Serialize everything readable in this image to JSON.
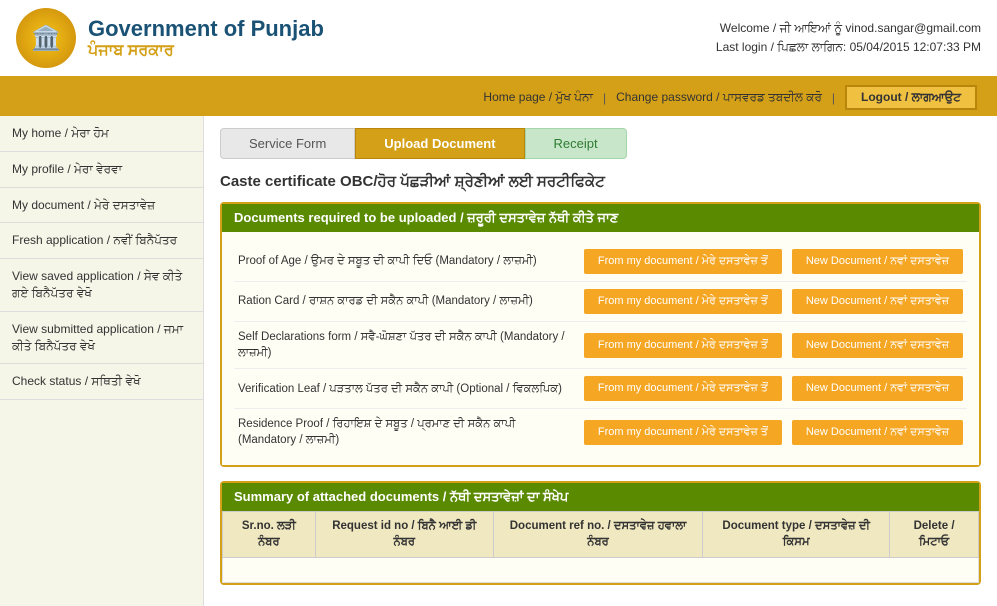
{
  "header": {
    "title": "Government of Punjab",
    "subtitle": "ਪੰਜਾਬ ਸਰਕਾਰ",
    "welcome_label": "Welcome / ਜੀ ਆਇਆਂ ਨੂੰ",
    "user_email": "vinod.sangar@gmail.com",
    "last_login_label": "Last login / ਪਿਛਲਾ ਲਾਗਿਨ:",
    "last_login_time": "05/04/2015 12:07:33 PM"
  },
  "navbar": {
    "home_link": "Home page / ਮੁੱਖ ਪੰਨਾ",
    "change_pwd_link": "Change password / ਪਾਸਵਰਡ ਤਬਦੀਲ ਕਰੋ",
    "logout_label": "Logout / ਲਾਗਆਉਟ"
  },
  "sidebar": {
    "items": [
      {
        "label": "My home / ਮੇਰਾ ਹੋਮ"
      },
      {
        "label": "My profile / ਮੇਰਾ ਵੇਰਵਾ"
      },
      {
        "label": "My document / ਮੇਰੇ ਦਸਤਾਵੇਜ਼"
      },
      {
        "label": "Fresh application / ਨਵੀਂ ਬਿਨੈਪੱਤਰ"
      },
      {
        "label": "View saved application / ਸੇਵ ਕੀਤੇ ਗਏ ਬਿਨੈਪੱਤਰ ਵੇਖੋ"
      },
      {
        "label": "View submitted application / ਜਮਾ ਕੀਤੇ ਬਿਨੈਪੱਤਰ ਵੇਖੋ"
      },
      {
        "label": "Check status / ਸਥਿਤੀ ਵੇਖੋ"
      }
    ]
  },
  "steps": [
    {
      "label": "Service Form",
      "state": "default"
    },
    {
      "label": "Upload Document",
      "state": "active"
    },
    {
      "label": "Receipt",
      "state": "done"
    }
  ],
  "page_title": "Caste certificate OBC/ਹੋਰ ਪੱਛੜੀਆਂ ਸ਼੍ਰੇਣੀਆਂ ਲਈ ਸਰਟੀਫਿਕੇਟ",
  "upload_section": {
    "header": "Documents required to be uploaded / ਜ਼ਰੂਰੀ ਦਸਤਾਵੇਜ਼ ਨੱਥੀ ਕੀਤੇ ਜਾਣ",
    "documents": [
      {
        "label": "Proof of Age / ਉਮਰ ਦੇ ਸਬੂਤ ਦੀ ਕਾਪੀ ਦਿਓ (Mandatory / ਲਾਜ਼ਮੀ)",
        "btn1": "From my document / ਮੇਰੇ ਦਸਤਾਵੇਜ਼ ਤੋਂ",
        "btn2": "New Document / ਨਵਾਂ ਦਸਤਾਵੇਜ਼"
      },
      {
        "label": "Ration Card / ਰਾਸ਼ਨ ਕਾਰਡ ਦੀ ਸਕੈਨ ਕਾਪੀ (Mandatory / ਲਾਜ਼ਮੀ)",
        "btn1": "From my document / ਮੇਰੇ ਦਸਤਾਵੇਜ਼ ਤੋਂ",
        "btn2": "New Document / ਨਵਾਂ ਦਸਤਾਵੇਜ਼"
      },
      {
        "label": "Self Declarations form / ਸਵੈ-ਘੋਸ਼ਣਾ ਪੱਤਰ ਦੀ ਸਕੈਨ ਕਾਪੀ (Mandatory / ਲਾਜ਼ਮੀ)",
        "btn1": "From my document / ਮੇਰੇ ਦਸਤਾਵੇਜ਼ ਤੋਂ",
        "btn2": "New Document / ਨਵਾਂ ਦਸਤਾਵੇਜ਼"
      },
      {
        "label": "Verification Leaf / ਪੜਤਾਲ ਪੱਤਰ ਦੀ ਸਕੈਨ ਕਾਪੀ (Optional / ਵਿਕਲਪਿਕ)",
        "btn1": "From my document / ਮੇਰੇ ਦਸਤਾਵੇਜ਼ ਤੋਂ",
        "btn2": "New Document / ਨਵਾਂ ਦਸਤਾਵੇਜ਼"
      },
      {
        "label": "Residence Proof / ਰਿਹਾਇਸ਼ ਦੇ ਸਬੂਤ / ਪ੍ਰਮਾਣ ਦੀ ਸਕੈਨ ਕਾਪੀ (Mandatory / ਲਾਜ਼ਮੀ)",
        "btn1": "From my document / ਮੇਰੇ ਦਸਤਾਵੇਜ਼ ਤੋਂ",
        "btn2": "New Document / ਨਵਾਂ ਦਸਤਾਵੇਜ਼"
      }
    ]
  },
  "summary_section": {
    "header": "Summary of attached documents / ਨੱਥੀ ਦਸਤਾਵੇਜ਼ਾਂ ਦਾ ਸੰਖੇਪ",
    "columns": [
      "Sr.no. ਲੜੀ ਨੰਬਰ",
      "Request id no / ਬਿਨੈ ਆਈ ਡੀ ਨੰਬਰ",
      "Document ref no. / ਦਸਤਾਵੇਜ਼ ਹਵਾਲਾ ਨੰਬਰ",
      "Document type / ਦਸਤਾਵੇਜ਼ ਦੀ ਕਿਸਮ",
      "Delete / ਮਿਟਾਓ"
    ]
  }
}
